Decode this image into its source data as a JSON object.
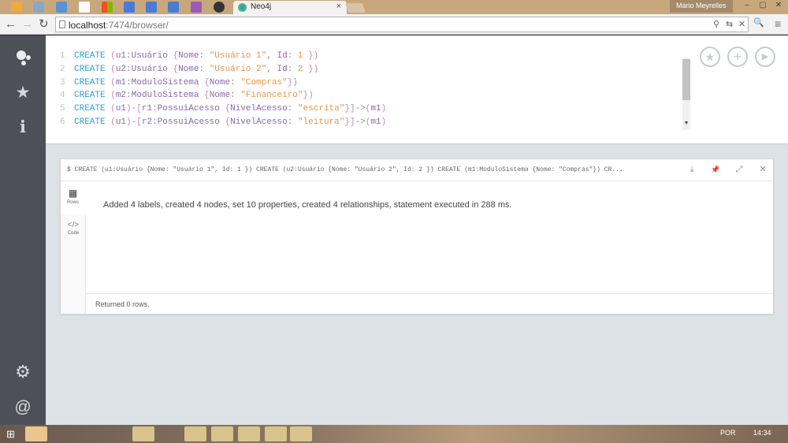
{
  "browser": {
    "tab_title": "Neo4j",
    "tab_close": "×",
    "user_name": "Mário Meyrelles",
    "url_host": "localhost",
    "url_rest": ":7474/browser/",
    "controls": {
      "minimize": "–",
      "maximize": "▢",
      "close": "✕"
    }
  },
  "icons": {
    "back": "←",
    "forward": "→",
    "reload": "↻",
    "pin": "⚲",
    "translate": "⇆",
    "extension": "✕",
    "search": "🔍",
    "menu": "≡",
    "favorites": "★",
    "info": "ℹ",
    "settings": "⚙",
    "about": "@",
    "star_btn": "★",
    "add_btn": "+",
    "run_btn": "▶",
    "download": "⤓",
    "pin_frame": "📌",
    "expand": "⤢",
    "close_frame": "✕",
    "rows": "▦",
    "code": "</>"
  },
  "editor": {
    "lines": [
      {
        "num": "1",
        "parts": [
          [
            "kw",
            "CREATE"
          ],
          [
            "tx",
            " "
          ],
          [
            "pn",
            "("
          ],
          [
            "idn",
            "u1"
          ],
          [
            "tx",
            ":"
          ],
          [
            "idn",
            "Usuário"
          ],
          [
            "tx",
            " "
          ],
          [
            "pn",
            "{"
          ],
          [
            "idn",
            "Nome"
          ],
          [
            "tx",
            ": "
          ],
          [
            "str",
            "\"Usuário 1\""
          ],
          [
            "tx",
            ", "
          ],
          [
            "idn",
            "Id"
          ],
          [
            "tx",
            ": "
          ],
          [
            "num",
            "1"
          ],
          [
            "tx",
            " "
          ],
          [
            "pn",
            "})"
          ]
        ]
      },
      {
        "num": "2",
        "parts": [
          [
            "kw",
            "CREATE"
          ],
          [
            "tx",
            " "
          ],
          [
            "pn",
            "("
          ],
          [
            "idn",
            "u2"
          ],
          [
            "tx",
            ":"
          ],
          [
            "idn",
            "Usuário"
          ],
          [
            "tx",
            " "
          ],
          [
            "pn",
            "{"
          ],
          [
            "idn",
            "Nome"
          ],
          [
            "tx",
            ": "
          ],
          [
            "str",
            "\"Usuário 2\""
          ],
          [
            "tx",
            ", "
          ],
          [
            "idn",
            "Id"
          ],
          [
            "tx",
            ": "
          ],
          [
            "num",
            "2"
          ],
          [
            "tx",
            " "
          ],
          [
            "pn",
            "})"
          ]
        ]
      },
      {
        "num": "3",
        "parts": [
          [
            "kw",
            "CREATE"
          ],
          [
            "tx",
            " "
          ],
          [
            "pn",
            "("
          ],
          [
            "idn",
            "m1"
          ],
          [
            "tx",
            ":"
          ],
          [
            "idn",
            "ModuloSistema"
          ],
          [
            "tx",
            " "
          ],
          [
            "pn",
            "{"
          ],
          [
            "idn",
            "Nome"
          ],
          [
            "tx",
            ": "
          ],
          [
            "str",
            "\"Compras\""
          ],
          [
            "pn",
            "})"
          ]
        ]
      },
      {
        "num": "4",
        "parts": [
          [
            "kw",
            "CREATE"
          ],
          [
            "tx",
            " "
          ],
          [
            "pn",
            "("
          ],
          [
            "idn",
            "m2"
          ],
          [
            "tx",
            ":"
          ],
          [
            "idn",
            "ModuloSistema"
          ],
          [
            "tx",
            " "
          ],
          [
            "pn",
            "{"
          ],
          [
            "idn",
            "Nome"
          ],
          [
            "tx",
            ": "
          ],
          [
            "str",
            "\"Financeiro\""
          ],
          [
            "pn",
            "})"
          ]
        ]
      },
      {
        "num": "5",
        "parts": [
          [
            "kw",
            "CREATE"
          ],
          [
            "tx",
            " "
          ],
          [
            "pn",
            "("
          ],
          [
            "idn",
            "u1"
          ],
          [
            "pn",
            ")"
          ],
          [
            "tx",
            "-"
          ],
          [
            "pn",
            "["
          ],
          [
            "idn",
            "r1"
          ],
          [
            "tx",
            ":"
          ],
          [
            "idn",
            "PossuiAcesso"
          ],
          [
            "tx",
            " "
          ],
          [
            "pn",
            "{"
          ],
          [
            "idn",
            "NivelAcesso"
          ],
          [
            "tx",
            ": "
          ],
          [
            "str",
            "\"escrita\""
          ],
          [
            "pn",
            "}]"
          ],
          [
            "tx",
            "->"
          ],
          [
            "pn",
            "("
          ],
          [
            "idn",
            "m1"
          ],
          [
            "pn",
            ")"
          ]
        ]
      },
      {
        "num": "6",
        "parts": [
          [
            "kw",
            "CREATE"
          ],
          [
            "tx",
            " "
          ],
          [
            "pn",
            "("
          ],
          [
            "idn",
            "u1"
          ],
          [
            "pn",
            ")"
          ],
          [
            "tx",
            "-"
          ],
          [
            "pn",
            "["
          ],
          [
            "idn",
            "r2"
          ],
          [
            "tx",
            ":"
          ],
          [
            "idn",
            "PossuiAcesso"
          ],
          [
            "tx",
            " "
          ],
          [
            "pn",
            "{"
          ],
          [
            "idn",
            "NivelAcesso"
          ],
          [
            "tx",
            ": "
          ],
          [
            "str",
            "\"leitura\""
          ],
          [
            "pn",
            "}]"
          ],
          [
            "tx",
            "->"
          ],
          [
            "pn",
            "("
          ],
          [
            "idn",
            "m1"
          ],
          [
            "pn",
            ")"
          ]
        ]
      }
    ]
  },
  "frame": {
    "command": "$ CREATE (u1:Usuário {Nome: \"Usuário 1\", Id: 1 }) CREATE (u2:Usuário {Nome: \"Usuário 2\", Id: 2 }) CREATE (m1:ModuloSistema {Nome: \"Compras\"}) CR...",
    "tab_rows": "Rows",
    "tab_code": "Code",
    "message": "Added 4 labels, created 4 nodes, set 10 properties, created 4 relationships, statement executed in 288 ms.",
    "footer": "Returned 0 rows."
  },
  "taskbar": {
    "language": "POR",
    "time": "14:34"
  }
}
